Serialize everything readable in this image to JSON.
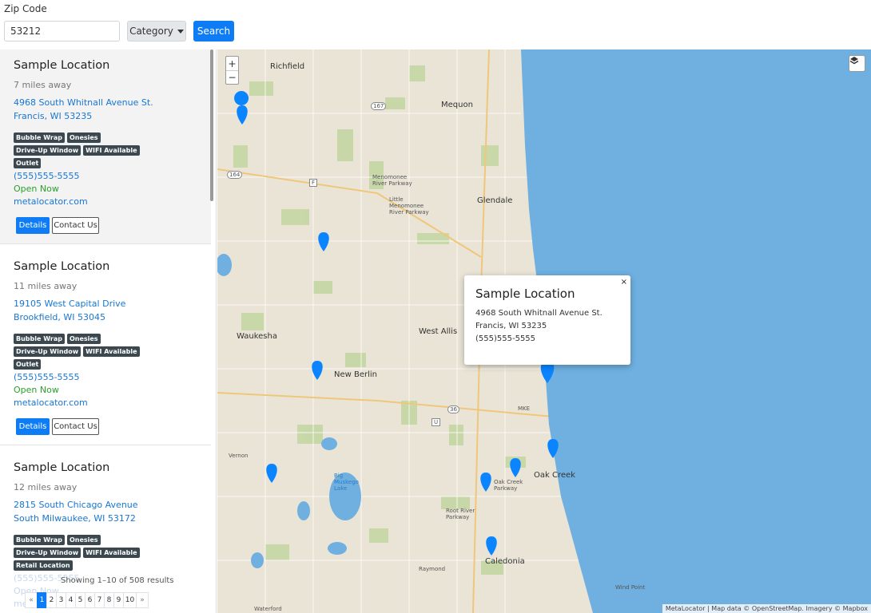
{
  "search": {
    "zip_label": "Zip Code",
    "zip_value": "53212",
    "category_label": "Category",
    "search_label": "Search"
  },
  "locations": [
    {
      "title": "Sample Location",
      "distance": "7 miles away",
      "address1": "4968 South Whitnall Avenue St.",
      "address2": "Francis, WI 53235",
      "tags": [
        [
          "Bubble Wrap",
          "Onesies"
        ],
        [
          "Drive-Up Window",
          "WIFI Available"
        ],
        [
          "Outlet"
        ]
      ],
      "phone": "(555)555-5555",
      "status": "Open Now",
      "website": "metalocator.com",
      "details": "Details",
      "contact": "Contact Us"
    },
    {
      "title": "Sample Location",
      "distance": "11 miles away",
      "address1": "19105 West Capital Drive",
      "address2": "Brookfield, WI 53045",
      "tags": [
        [
          "Bubble Wrap",
          "Onesies"
        ],
        [
          "Drive-Up Window",
          "WIFI Available"
        ],
        [
          "Outlet"
        ]
      ],
      "phone": "(555)555-5555",
      "status": "Open Now",
      "website": "metalocator.com",
      "details": "Details",
      "contact": "Contact Us"
    },
    {
      "title": "Sample Location",
      "distance": "12 miles away",
      "address1": "2815 South Chicago Avenue",
      "address2": "South Milwaukee, WI 53172",
      "tags": [
        [
          "Bubble Wrap",
          "Onesies"
        ],
        [
          "Drive-Up Window",
          "WIFI Available"
        ],
        [
          "Retail Location"
        ]
      ],
      "phone": "(555)555-5555",
      "status": "Open Now",
      "website": "metalocator.com"
    }
  ],
  "pagination": {
    "results_text": "Showing 1–10 of 508 results",
    "prev": "«",
    "next": "»",
    "pages": [
      "1",
      "2",
      "3",
      "4",
      "5",
      "6",
      "7",
      "8",
      "9",
      "10"
    ],
    "current": "1"
  },
  "map": {
    "zoom_in": "+",
    "zoom_out": "−",
    "attribution": "MetaLocator | Map data © OpenStreetMap. Imagery © Mapbox",
    "labels": {
      "richfield": "Richfield",
      "mequon": "Mequon",
      "glendale": "Glendale",
      "waukesha": "Waukesha",
      "west_allis": "West Allis",
      "new_berlin": "New Berlin",
      "vernon": "Vernon",
      "oak_creek": "Oak Creek",
      "caledonia": "Caledonia",
      "raymond": "Raymond",
      "wind_point": "Wind Point",
      "waterford": "Waterford",
      "menomonee": "Menomonee River Parkway",
      "little_menomonee": "Little Menomonee River Parkway",
      "oak_creek_parkway": "Oak Creek Parkway",
      "root_river": "Root River Parkway",
      "big_muskego": "Big Muskego Lake",
      "mke": "MKE",
      "hwy_167": "167",
      "hwy_164": "164",
      "hwy_36": "36",
      "hwy_u": "U",
      "hwy_f": "F"
    },
    "popup": {
      "title": "Sample Location",
      "line1": "4968 South Whitnall Avenue St.",
      "line2": "Francis, WI 53235",
      "line3": "(555)555-5555",
      "close": "×"
    },
    "colors": {
      "water": "#6fb0e0",
      "land": "#e9e4d6",
      "park": "#c4d6a3",
      "marker": "#0a84ff"
    }
  }
}
